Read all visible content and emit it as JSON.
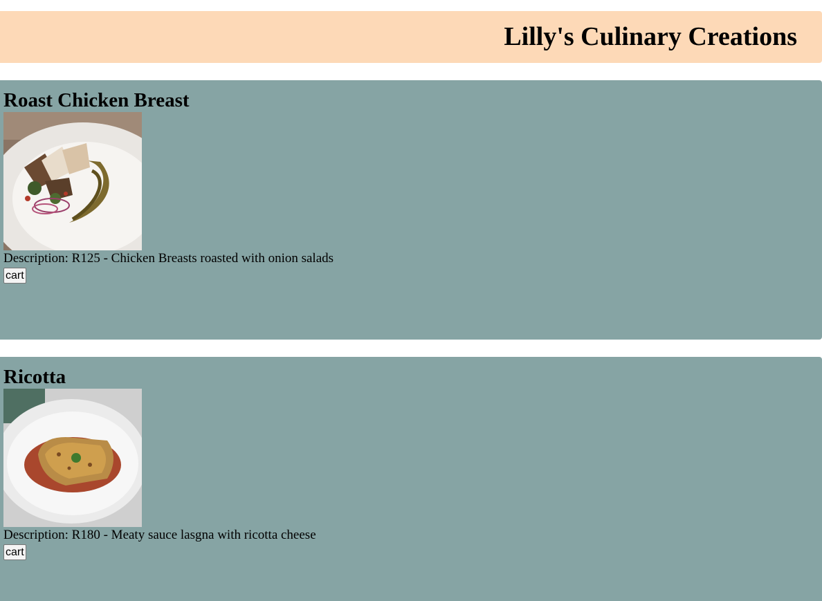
{
  "header": {
    "title": "Lilly's Culinary Creations"
  },
  "items": [
    {
      "name": "Roast Chicken Breast",
      "description": "Description: R125 - Chicken Breasts roasted with onion salads",
      "button_label": "cart"
    },
    {
      "name": "Ricotta",
      "description": "Description: R180 - Meaty sauce lasgna with ricotta cheese",
      "button_label": "cart"
    }
  ],
  "colors": {
    "header_bg": "#fdd9b7",
    "card_bg": "#86a4a4"
  }
}
